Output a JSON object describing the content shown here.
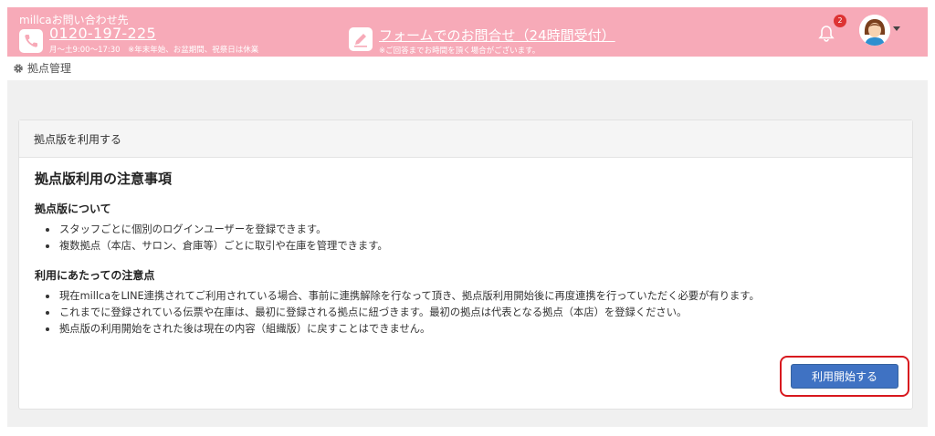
{
  "header": {
    "contact_label": "millcaお問い合わせ先",
    "phone_number": "0120-197-225",
    "phone_hours": "月～土9:00～17:30　※年末年始、お盆期間、祝祭日は休業",
    "form_link": "フォームでのお問合せ（24時間受付）",
    "form_note": "※ご回答までお時間を頂く場合がございます。",
    "notification_count": "2",
    "icons": {
      "phone": "phone-icon",
      "form": "pencil-icon",
      "notifications": "bell-icon",
      "user": "user-avatar",
      "menu": "caret-down-icon"
    }
  },
  "breadcrumb": {
    "icon": "gear-icon",
    "label": "拠点管理"
  },
  "card": {
    "header": "拠点版を利用する",
    "title": "拠点版利用の注意事項",
    "sections": [
      {
        "heading": "拠点版について",
        "items": [
          "スタッフごとに個別のログインユーザーを登録できます。",
          "複数拠点（本店、サロン、倉庫等）ごとに取引や在庫を管理できます。"
        ]
      },
      {
        "heading": "利用にあたっての注意点",
        "items": [
          "現在millcaをLINE連携されてご利用されている場合、事前に連携解除を行なって頂き、拠点版利用開始後に再度連携を行っていただく必要が有ります。",
          "これまでに登録されている伝票や在庫は、最初に登録される拠点に紐づきます。最初の拠点は代表となる拠点（本店）を登録ください。",
          "拠点版の利用開始をされた後は現在の内容（組織版）に戻すことはできません。"
        ]
      }
    ],
    "start_button": "利用開始する"
  },
  "colors": {
    "header_bg": "#f7aab8",
    "primary_button": "#3f72c3",
    "highlight_border": "#d8181e",
    "badge": "#dd3333"
  }
}
